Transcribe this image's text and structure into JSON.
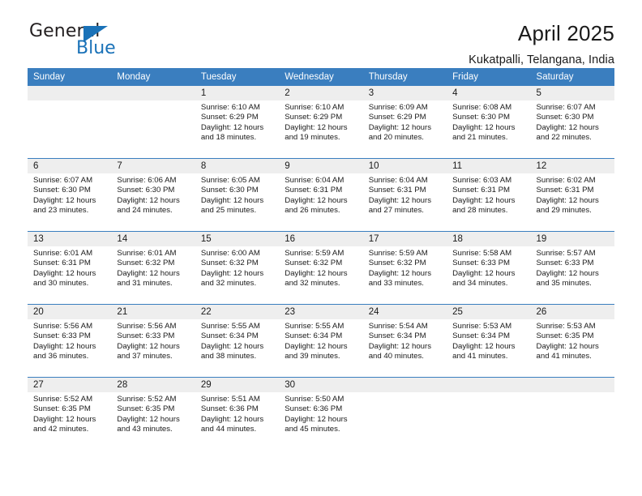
{
  "brand": {
    "name_top": "General",
    "name_bottom": "Blue",
    "triangle_icon": "triangle-logo-icon",
    "color_dark": "#231f20",
    "color_blue": "#1a72b8"
  },
  "header": {
    "title": "April 2025",
    "subtitle": "Kukatpalli, Telangana, India"
  },
  "theme": {
    "header_blue": "#3a7ebf",
    "band_gray": "#eeeeee",
    "text": "#1a1a1a"
  },
  "weekday_headers": [
    "Sunday",
    "Monday",
    "Tuesday",
    "Wednesday",
    "Thursday",
    "Friday",
    "Saturday"
  ],
  "weeks": [
    [
      {
        "day": "",
        "empty": true,
        "lines": [
          "",
          "",
          "",
          ""
        ]
      },
      {
        "day": "",
        "empty": true,
        "lines": [
          "",
          "",
          "",
          ""
        ]
      },
      {
        "day": "1",
        "lines": [
          "Sunrise: 6:10 AM",
          "Sunset: 6:29 PM",
          "Daylight: 12 hours",
          "and 18 minutes."
        ]
      },
      {
        "day": "2",
        "lines": [
          "Sunrise: 6:10 AM",
          "Sunset: 6:29 PM",
          "Daylight: 12 hours",
          "and 19 minutes."
        ]
      },
      {
        "day": "3",
        "lines": [
          "Sunrise: 6:09 AM",
          "Sunset: 6:29 PM",
          "Daylight: 12 hours",
          "and 20 minutes."
        ]
      },
      {
        "day": "4",
        "lines": [
          "Sunrise: 6:08 AM",
          "Sunset: 6:30 PM",
          "Daylight: 12 hours",
          "and 21 minutes."
        ]
      },
      {
        "day": "5",
        "lines": [
          "Sunrise: 6:07 AM",
          "Sunset: 6:30 PM",
          "Daylight: 12 hours",
          "and 22 minutes."
        ]
      }
    ],
    [
      {
        "day": "6",
        "lines": [
          "Sunrise: 6:07 AM",
          "Sunset: 6:30 PM",
          "Daylight: 12 hours",
          "and 23 minutes."
        ]
      },
      {
        "day": "7",
        "lines": [
          "Sunrise: 6:06 AM",
          "Sunset: 6:30 PM",
          "Daylight: 12 hours",
          "and 24 minutes."
        ]
      },
      {
        "day": "8",
        "lines": [
          "Sunrise: 6:05 AM",
          "Sunset: 6:30 PM",
          "Daylight: 12 hours",
          "and 25 minutes."
        ]
      },
      {
        "day": "9",
        "lines": [
          "Sunrise: 6:04 AM",
          "Sunset: 6:31 PM",
          "Daylight: 12 hours",
          "and 26 minutes."
        ]
      },
      {
        "day": "10",
        "lines": [
          "Sunrise: 6:04 AM",
          "Sunset: 6:31 PM",
          "Daylight: 12 hours",
          "and 27 minutes."
        ]
      },
      {
        "day": "11",
        "lines": [
          "Sunrise: 6:03 AM",
          "Sunset: 6:31 PM",
          "Daylight: 12 hours",
          "and 28 minutes."
        ]
      },
      {
        "day": "12",
        "lines": [
          "Sunrise: 6:02 AM",
          "Sunset: 6:31 PM",
          "Daylight: 12 hours",
          "and 29 minutes."
        ]
      }
    ],
    [
      {
        "day": "13",
        "lines": [
          "Sunrise: 6:01 AM",
          "Sunset: 6:31 PM",
          "Daylight: 12 hours",
          "and 30 minutes."
        ]
      },
      {
        "day": "14",
        "lines": [
          "Sunrise: 6:01 AM",
          "Sunset: 6:32 PM",
          "Daylight: 12 hours",
          "and 31 minutes."
        ]
      },
      {
        "day": "15",
        "lines": [
          "Sunrise: 6:00 AM",
          "Sunset: 6:32 PM",
          "Daylight: 12 hours",
          "and 32 minutes."
        ]
      },
      {
        "day": "16",
        "lines": [
          "Sunrise: 5:59 AM",
          "Sunset: 6:32 PM",
          "Daylight: 12 hours",
          "and 32 minutes."
        ]
      },
      {
        "day": "17",
        "lines": [
          "Sunrise: 5:59 AM",
          "Sunset: 6:32 PM",
          "Daylight: 12 hours",
          "and 33 minutes."
        ]
      },
      {
        "day": "18",
        "lines": [
          "Sunrise: 5:58 AM",
          "Sunset: 6:33 PM",
          "Daylight: 12 hours",
          "and 34 minutes."
        ]
      },
      {
        "day": "19",
        "lines": [
          "Sunrise: 5:57 AM",
          "Sunset: 6:33 PM",
          "Daylight: 12 hours",
          "and 35 minutes."
        ]
      }
    ],
    [
      {
        "day": "20",
        "lines": [
          "Sunrise: 5:56 AM",
          "Sunset: 6:33 PM",
          "Daylight: 12 hours",
          "and 36 minutes."
        ]
      },
      {
        "day": "21",
        "lines": [
          "Sunrise: 5:56 AM",
          "Sunset: 6:33 PM",
          "Daylight: 12 hours",
          "and 37 minutes."
        ]
      },
      {
        "day": "22",
        "lines": [
          "Sunrise: 5:55 AM",
          "Sunset: 6:34 PM",
          "Daylight: 12 hours",
          "and 38 minutes."
        ]
      },
      {
        "day": "23",
        "lines": [
          "Sunrise: 5:55 AM",
          "Sunset: 6:34 PM",
          "Daylight: 12 hours",
          "and 39 minutes."
        ]
      },
      {
        "day": "24",
        "lines": [
          "Sunrise: 5:54 AM",
          "Sunset: 6:34 PM",
          "Daylight: 12 hours",
          "and 40 minutes."
        ]
      },
      {
        "day": "25",
        "lines": [
          "Sunrise: 5:53 AM",
          "Sunset: 6:34 PM",
          "Daylight: 12 hours",
          "and 41 minutes."
        ]
      },
      {
        "day": "26",
        "lines": [
          "Sunrise: 5:53 AM",
          "Sunset: 6:35 PM",
          "Daylight: 12 hours",
          "and 41 minutes."
        ]
      }
    ],
    [
      {
        "day": "27",
        "lines": [
          "Sunrise: 5:52 AM",
          "Sunset: 6:35 PM",
          "Daylight: 12 hours",
          "and 42 minutes."
        ]
      },
      {
        "day": "28",
        "lines": [
          "Sunrise: 5:52 AM",
          "Sunset: 6:35 PM",
          "Daylight: 12 hours",
          "and 43 minutes."
        ]
      },
      {
        "day": "29",
        "lines": [
          "Sunrise: 5:51 AM",
          "Sunset: 6:36 PM",
          "Daylight: 12 hours",
          "and 44 minutes."
        ]
      },
      {
        "day": "30",
        "lines": [
          "Sunrise: 5:50 AM",
          "Sunset: 6:36 PM",
          "Daylight: 12 hours",
          "and 45 minutes."
        ]
      },
      {
        "day": "",
        "empty": true,
        "lines": [
          "",
          "",
          "",
          ""
        ]
      },
      {
        "day": "",
        "empty": true,
        "lines": [
          "",
          "",
          "",
          ""
        ]
      },
      {
        "day": "",
        "empty": true,
        "lines": [
          "",
          "",
          "",
          ""
        ]
      }
    ]
  ]
}
